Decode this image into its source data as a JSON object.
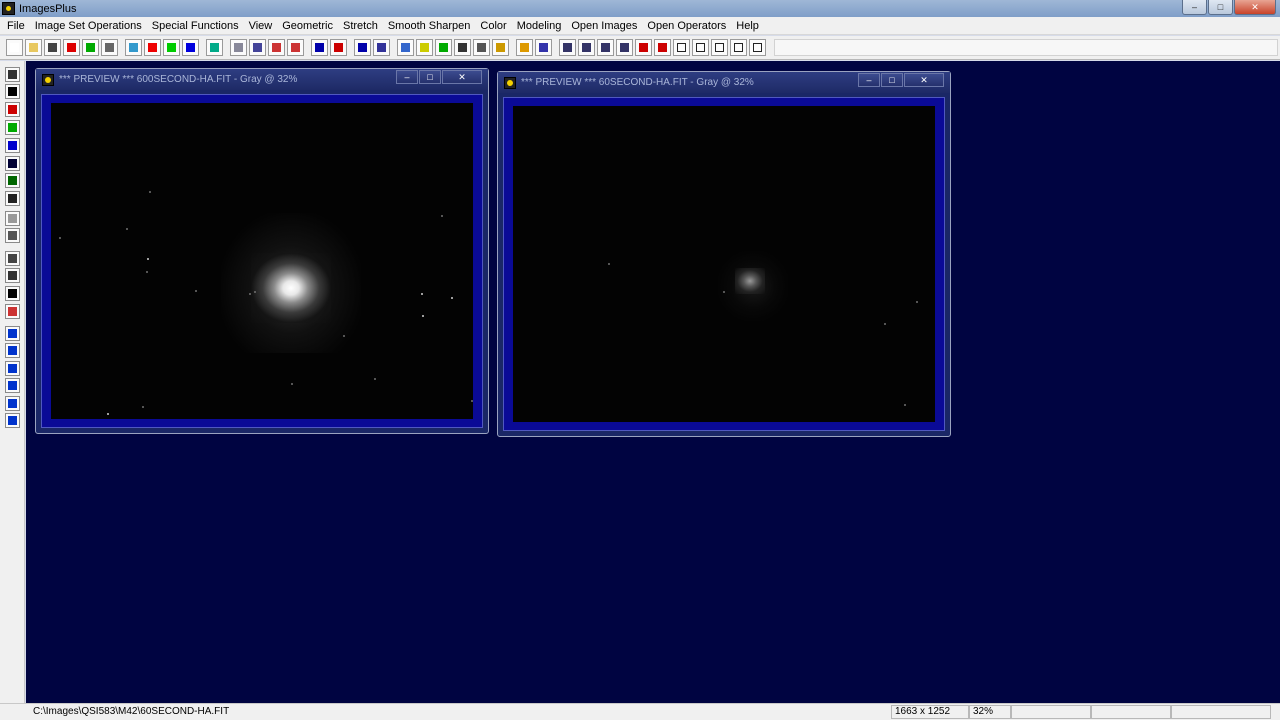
{
  "app": {
    "title": "ImagesPlus"
  },
  "window_controls": {
    "minimize": "–",
    "maximize": "□",
    "close": "✕"
  },
  "menu": [
    "File",
    "Image Set Operations",
    "Special Functions",
    "View",
    "Geometric",
    "Stretch",
    "Smooth Sharpen",
    "Color",
    "Modeling",
    "Open Images",
    "Open Operators",
    "Help"
  ],
  "toolbar_icons": [
    "new-file-icon",
    "open-folder-icon",
    "save-icon",
    "close-red-icon",
    "close-green-icon",
    "copy-icon",
    "rgb-channels-icon",
    "red-channel-icon",
    "green-channel-icon",
    "blue-channel-icon",
    "grid-icon",
    "undo-icon",
    "redo-icon",
    "undo-red-icon",
    "redo-red-icon",
    "dot-icon",
    "record-icon",
    "dotted-line-icon",
    "points-icon",
    "mountain-icon",
    "angle-icon",
    "add-icon",
    "crosshair-icon",
    "calculator-icon",
    "camera-icon",
    "pencil-icon",
    "grid-select-icon",
    "zoom-in-icon",
    "zoom-out-icon",
    "zoom-fit-icon",
    "zoom-actual-icon",
    "plus-box-icon",
    "minus-box-icon",
    "square-large-icon",
    "square-medium-icon",
    "square-small-icon",
    "square-xsmall-icon",
    "square-tiny-icon"
  ],
  "left_tools": [
    "save-tool-icon",
    "black-square-icon",
    "red-square-icon",
    "green-square-icon",
    "blue-square-icon",
    "black-blue-icon",
    "green-black-icon",
    "white-square-icon",
    "ring-icon",
    "diagonal-icon",
    "select-box-icon",
    "columns-icon",
    "black-bar-icon",
    "crop-icon",
    "move-icon",
    "up-arrow-icon",
    "right-arrow-icon",
    "rotate-left-icon",
    "rotate-right-icon",
    "frames-icon"
  ],
  "windows": [
    {
      "title": "*** PREVIEW *** 600SECOND-HA.FIT - Gray @ 32%"
    },
    {
      "title": "*** PREVIEW *** 60SECOND-HA.FIT - Gray @ 32%"
    }
  ],
  "status": {
    "path": "C:\\Images\\QSI583\\M42\\60SECOND-HA.FIT",
    "dimensions": "1663 x 1252",
    "zoom": "32%"
  }
}
